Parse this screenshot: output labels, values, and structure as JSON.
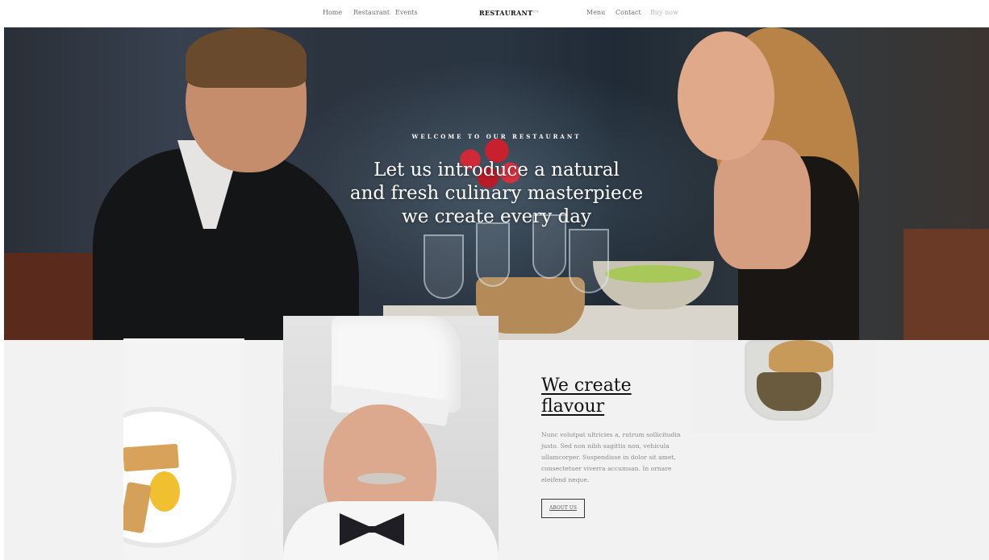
{
  "nav": {
    "left_links": [
      "Home",
      "Restaurant",
      "Events"
    ],
    "logo": "RESTAURANT",
    "logo_tm": "TM",
    "right_links": [
      "Menu",
      "Contact",
      "Buy now"
    ]
  },
  "hero": {
    "kicker": "WELCOME TO OUR RESTAURANT",
    "headline_lines": [
      "Let us introduce a natural",
      "and fresh culinary masterpiece",
      "we create every day"
    ]
  },
  "feature": {
    "title_lines": [
      "We create",
      "flavour"
    ],
    "body": "Nunc volutpat ultricies a, rutrum sollicitudin justo. Sed non nibh sagittis non, vehicula ullamcorper. Suspendisse in dolor sit amet, consectetuer viverra accumsan. In ornare eleifend neque.",
    "button_label": "ABOUT US"
  }
}
